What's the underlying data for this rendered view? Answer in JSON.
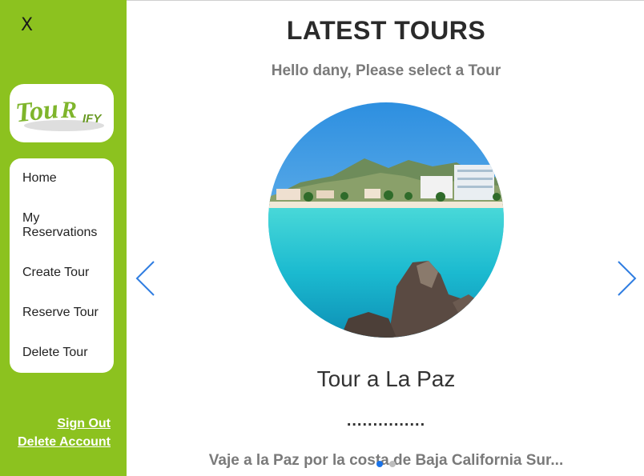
{
  "sidebar": {
    "close_label": "X",
    "logo_text": "TOURIFY",
    "menu": [
      {
        "label": "Home"
      },
      {
        "label": "My Reservations"
      },
      {
        "label": "Create Tour"
      },
      {
        "label": "Reserve Tour"
      },
      {
        "label": "Delete Tour"
      }
    ],
    "sign_out_label": "Sign Out",
    "delete_account_label": "Delete Account",
    "background_color": "#8cc21f"
  },
  "main": {
    "title": "LATEST TOURS",
    "greeting": "Hello dany, Please select a Tour",
    "carousel": {
      "prev_icon": "chevron-left-icon",
      "next_icon": "chevron-right-icon",
      "active_index": 0,
      "slide_count": 2,
      "arrow_color": "#2f7de1",
      "active_dot_color": "#1a73e8",
      "inactive_dot_color": "#bdbdbd",
      "slide": {
        "name": "Tour a La Paz",
        "dots": "...............",
        "description": "Vaje a la Paz por la costa de Baja California Sur..."
      }
    }
  }
}
